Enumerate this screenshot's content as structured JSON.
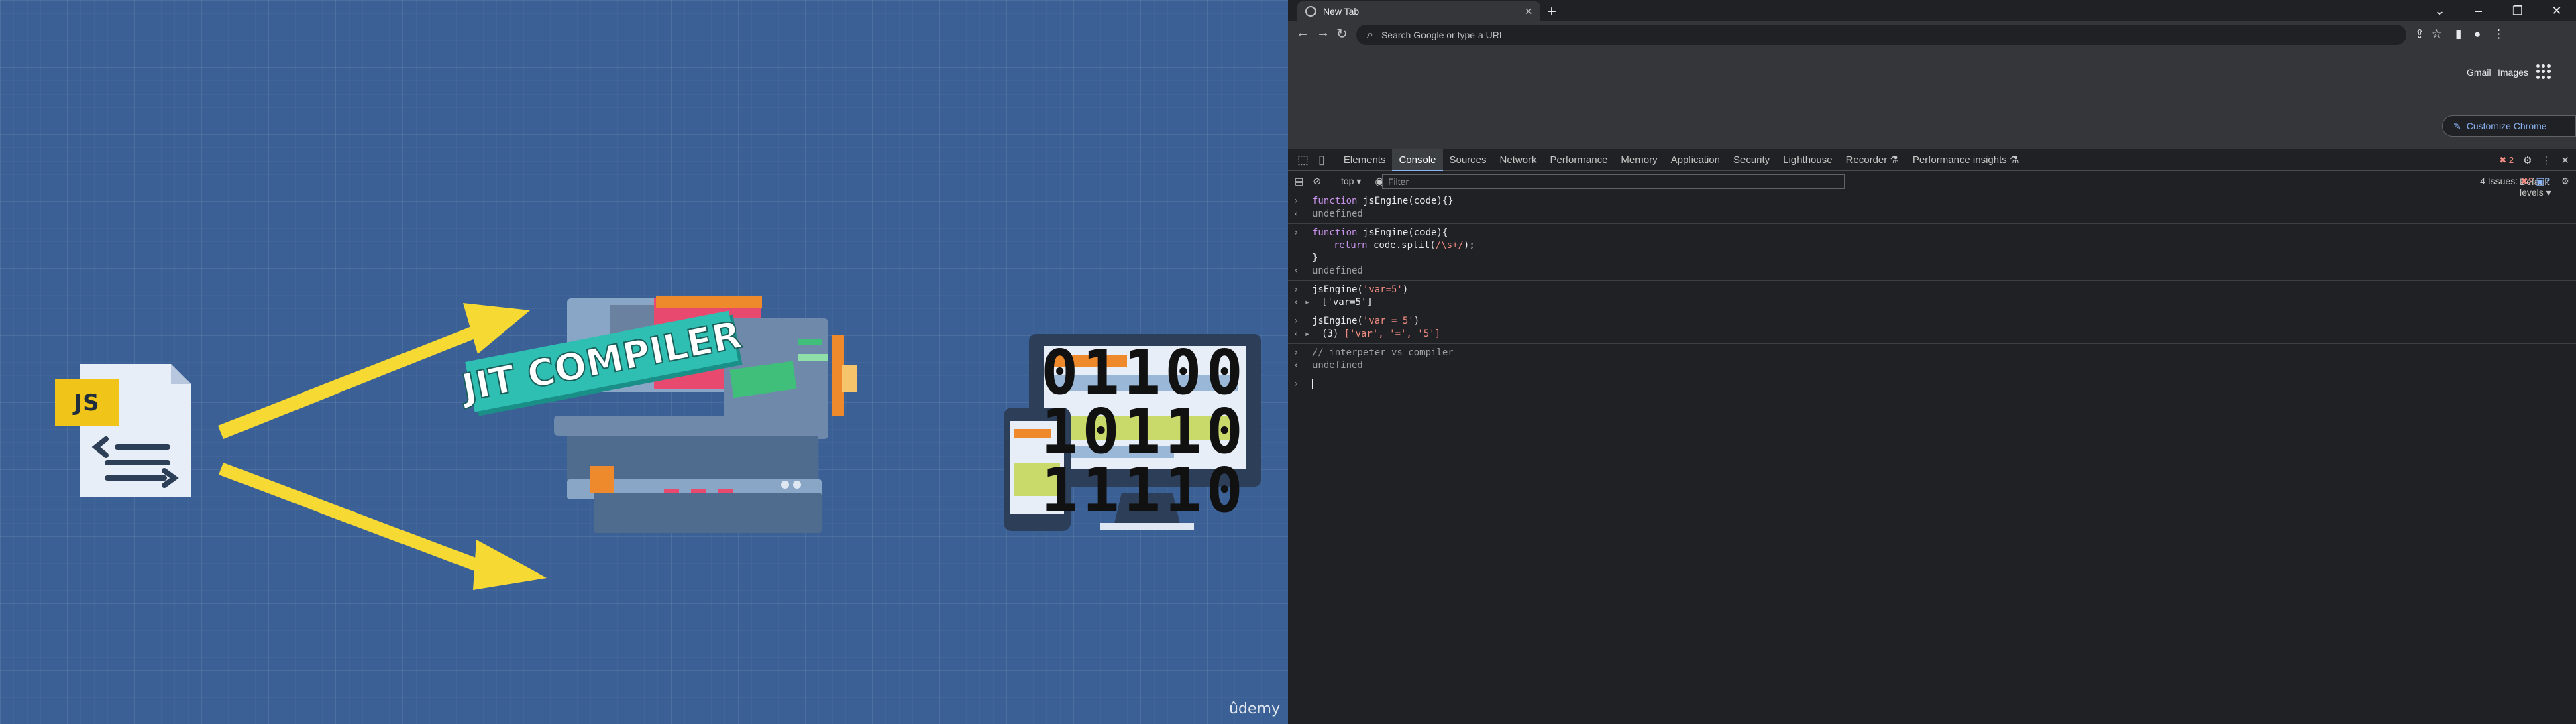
{
  "slide": {
    "js_badge": "JS",
    "banner": "JIT COMPILER",
    "binary_rows": [
      "01100",
      "10110",
      "11110"
    ],
    "watermark": "ûdemy",
    "colors": {
      "background": "#3b6096",
      "arrow": "#f6d932",
      "banner": "#2fbfb2",
      "js_badge": "#f0c419"
    },
    "icons": [
      "js-file-icon",
      "arrow-icon",
      "compiler-machine-icon",
      "devices-icon"
    ]
  },
  "browser": {
    "tab_title": "New Tab",
    "omnibox_placeholder": "Search Google or type a URL",
    "ntp_links": {
      "gmail": "Gmail",
      "images": "Images"
    },
    "customize_label": "Customize Chrome",
    "devtools": {
      "tabs": [
        "Elements",
        "Console",
        "Sources",
        "Network",
        "Performance",
        "Memory",
        "Application",
        "Security",
        "Lighthouse",
        "Recorder ⚗",
        "Performance insights ⚗"
      ],
      "active_tab": "Console",
      "error_count": "2",
      "context": "top",
      "filter_placeholder": "Filter",
      "levels": "Default levels",
      "issues": {
        "label": "4 Issues:",
        "errors": "2",
        "info": "2"
      }
    },
    "console": {
      "l1": "jsEngine(code){}",
      "undef1": "undefined",
      "l2_name": "jsEngine(code){",
      "l2_body_kw": "return",
      "l2_body_a": " code.split(",
      "l2_body_re": "/\\s+/",
      "l2_body_b": ");",
      "l2_close": "}",
      "undef2": "undefined",
      "l3_call": "jsEngine(",
      "l3_arg": "'var=5'",
      "l3_close": ")",
      "l3_out": "['var=5']",
      "l4_call": "jsEngine(",
      "l4_arg": "'var = 5'",
      "l4_close": ")",
      "l4_out_count": "(3) ",
      "l4_out_items": "['var', '=', '5']",
      "comment": "// interpeter vs compiler",
      "undef3": "undefined",
      "function_kw": "function"
    }
  }
}
